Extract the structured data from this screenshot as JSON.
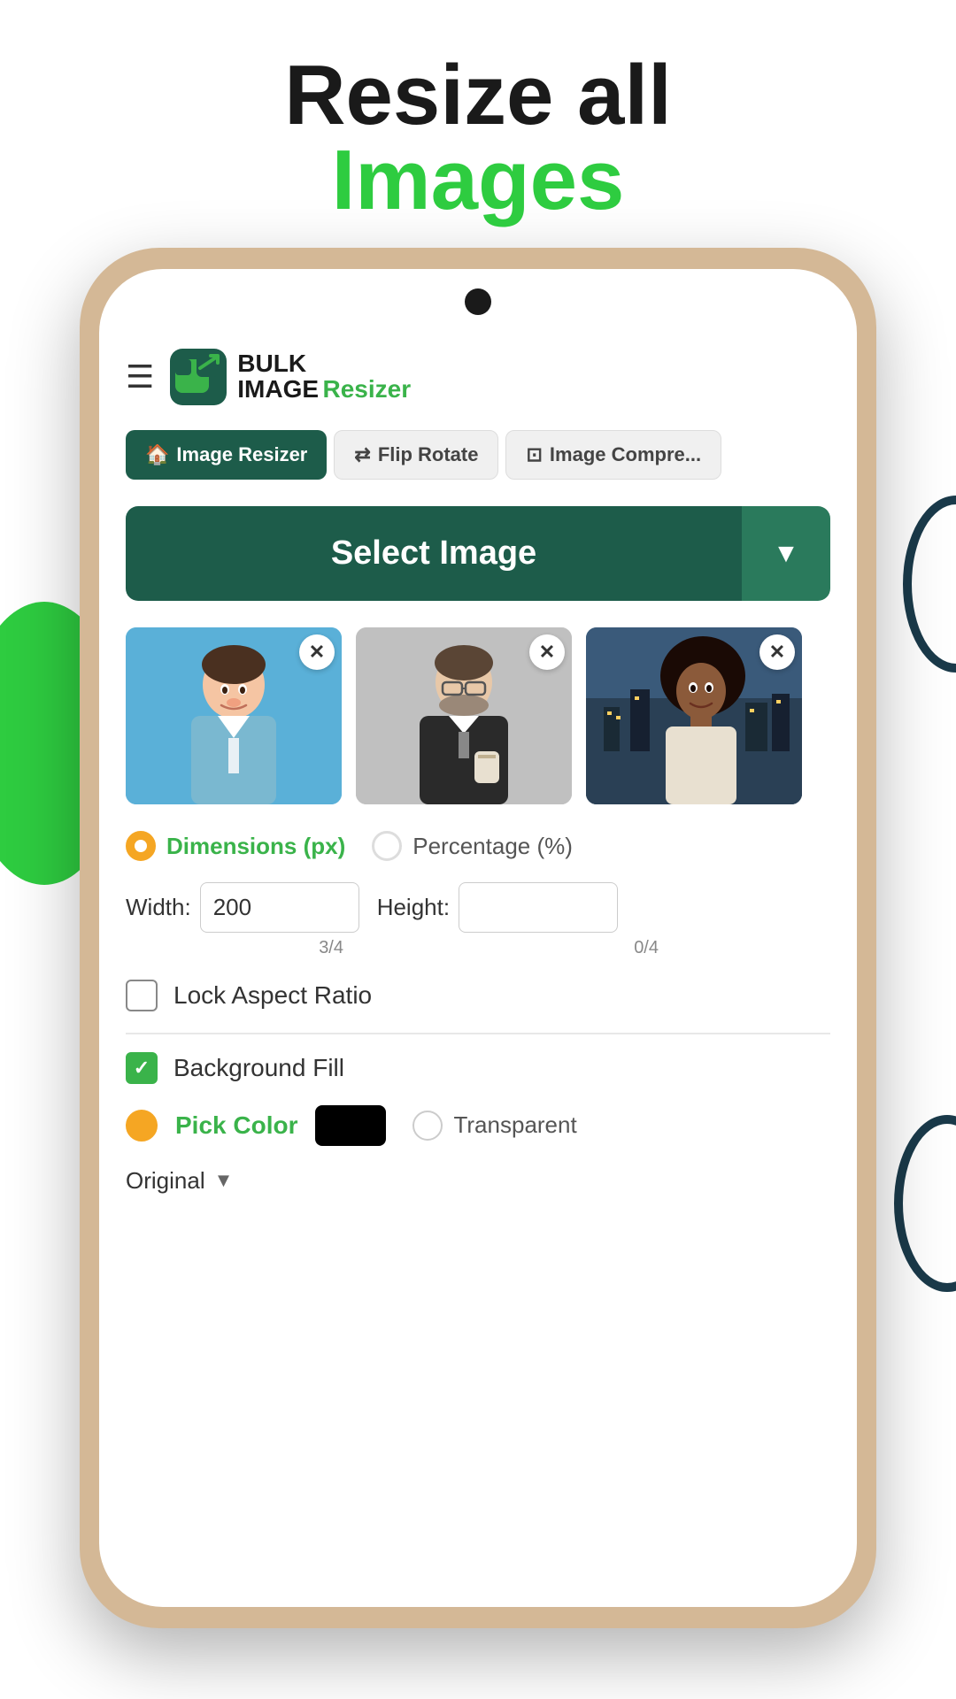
{
  "header": {
    "line1": "Resize all",
    "line2": "Images"
  },
  "app": {
    "logo": {
      "bulk": "BULK",
      "image": "IMAGE",
      "resizer": "Resizer"
    },
    "tabs": [
      {
        "id": "image-resizer",
        "label": "Image Resizer",
        "active": true
      },
      {
        "id": "flip-rotate",
        "label": "Flip Rotate",
        "active": false
      },
      {
        "id": "image-compress",
        "label": "Image Compre...",
        "active": false
      }
    ],
    "select_image_btn": "Select Image",
    "images": [
      {
        "id": "img1",
        "bg": "blue",
        "alt": "Man in blue shirt"
      },
      {
        "id": "img2",
        "bg": "gray",
        "alt": "Man in suit"
      },
      {
        "id": "img3",
        "bg": "night",
        "alt": "Woman looking up"
      }
    ],
    "dimension_options": [
      {
        "id": "px",
        "label": "Dimensions (px)",
        "active": true
      },
      {
        "id": "percent",
        "label": "Percentage (%)",
        "active": false
      }
    ],
    "width_label": "Width:",
    "width_value": "200",
    "width_counter": "3/4",
    "height_label": "Height:",
    "height_value": "",
    "height_counter": "0/4",
    "lock_aspect_label": "Lock Aspect Ratio",
    "lock_aspect_checked": false,
    "background_fill_label": "Background Fill",
    "background_fill_checked": true,
    "pick_color_label": "Pick Color",
    "color_swatch": "#000000",
    "transparent_label": "Transparent",
    "original_label": "Original"
  },
  "colors": {
    "primary": "#1d5c4a",
    "green": "#3ab34a",
    "orange": "#f5a623",
    "tab_active_bg": "#1d5c4a",
    "tab_inactive_bg": "#f0f0f0"
  }
}
